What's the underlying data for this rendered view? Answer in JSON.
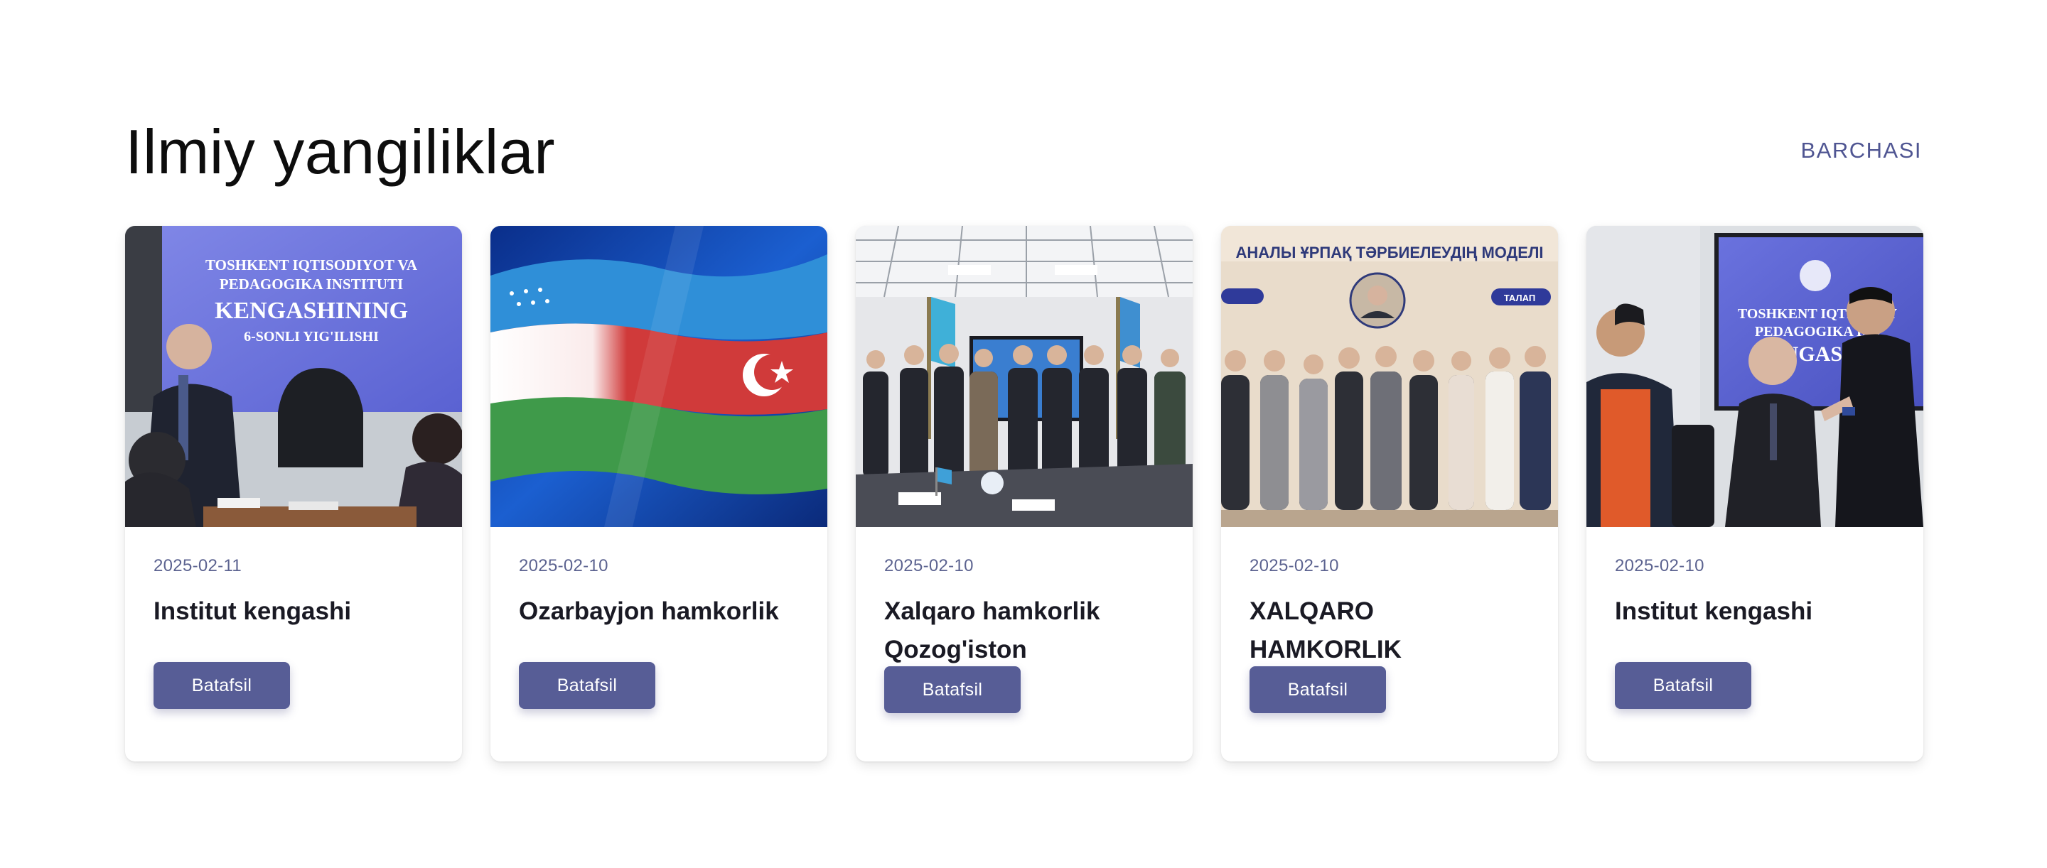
{
  "section": {
    "title": "Ilmiy yangiliklar",
    "see_all": "BARCHASI"
  },
  "cards": [
    {
      "date": "2025-02-11",
      "headline": "Institut kengashi",
      "button": "Batafsil",
      "image_text": [
        "TOSHKENT IQTISODIYOT VA",
        "PEDAGOGIKA INSTITUTI",
        "KENGASHINING",
        "6-SONLI YIG'ILISHI"
      ]
    },
    {
      "date": "2025-02-10",
      "headline": "Ozarbayjon hamkorlik",
      "button": "Batafsil"
    },
    {
      "date": "2025-02-10",
      "headline": "Xalqaro hamkorlik Qozog'iston",
      "button": "Batafsil"
    },
    {
      "date": "2025-02-10",
      "headline": "XALQARO HAMKORLIK",
      "button": "Batafsil",
      "image_text": [
        "АНАЛЫ ҰРПАҚ ТӘРБИЕЛЕУДІҢ МОДЕЛІ",
        "ТАЛАП"
      ]
    },
    {
      "date": "2025-02-10",
      "headline": "Institut kengashi",
      "button": "Batafsil",
      "image_text": [
        "TOSHKENT IQTISODIY",
        "PEDAGOGIKA INS",
        "KENGASHIN"
      ]
    }
  ],
  "colors": {
    "accent": "#575d96",
    "link": "#4f5592",
    "date": "#5c6390"
  }
}
